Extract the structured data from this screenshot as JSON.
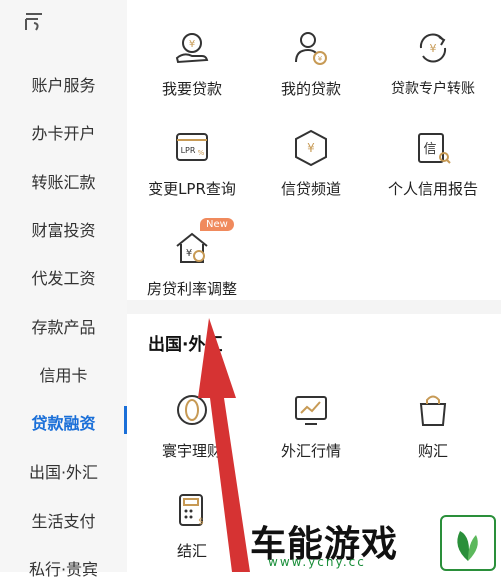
{
  "sidebar": {
    "items": [
      {
        "label": "账户服务"
      },
      {
        "label": "办卡开户"
      },
      {
        "label": "转账汇款"
      },
      {
        "label": "财富投资"
      },
      {
        "label": "代发工资"
      },
      {
        "label": "存款产品"
      },
      {
        "label": "信用卡"
      },
      {
        "label": "贷款融资"
      },
      {
        "label": "出国·外汇"
      },
      {
        "label": "生活支付"
      },
      {
        "label": "私行·贵宾"
      }
    ],
    "active_index": 7
  },
  "loans": {
    "tiles": [
      {
        "label": "我要贷款",
        "icon": "hand-coin-icon"
      },
      {
        "label": "我的贷款",
        "icon": "user-yen-icon"
      },
      {
        "label": "贷款专户转账",
        "icon": "yen-transfer-icon"
      },
      {
        "label": "变更LPR查询",
        "icon": "lpr-card-icon"
      },
      {
        "label": "信贷频道",
        "icon": "hexagon-yen-icon"
      },
      {
        "label": "个人信用报告",
        "icon": "credit-report-icon"
      },
      {
        "label": "房贷利率调整",
        "icon": "house-yen-icon"
      }
    ],
    "badge": "New",
    "lpr_icon_text": "LPR",
    "report_icon_text": "信"
  },
  "fx": {
    "title": "出国·外汇",
    "tiles": [
      {
        "label": "寰宇理财",
        "icon": "globe-coin-icon"
      },
      {
        "label": "外汇行情",
        "icon": "chart-screen-icon"
      },
      {
        "label": "购汇",
        "icon": "shopping-bag-icon"
      },
      {
        "label": "结汇",
        "icon": "calculator-icon"
      }
    ]
  },
  "watermark": {
    "text": "车能游戏",
    "url": "www.ycny.cc"
  },
  "colors": {
    "accent": "#1a6fd8",
    "icon_gold": "#c79a55",
    "arrow": "#d63333"
  }
}
